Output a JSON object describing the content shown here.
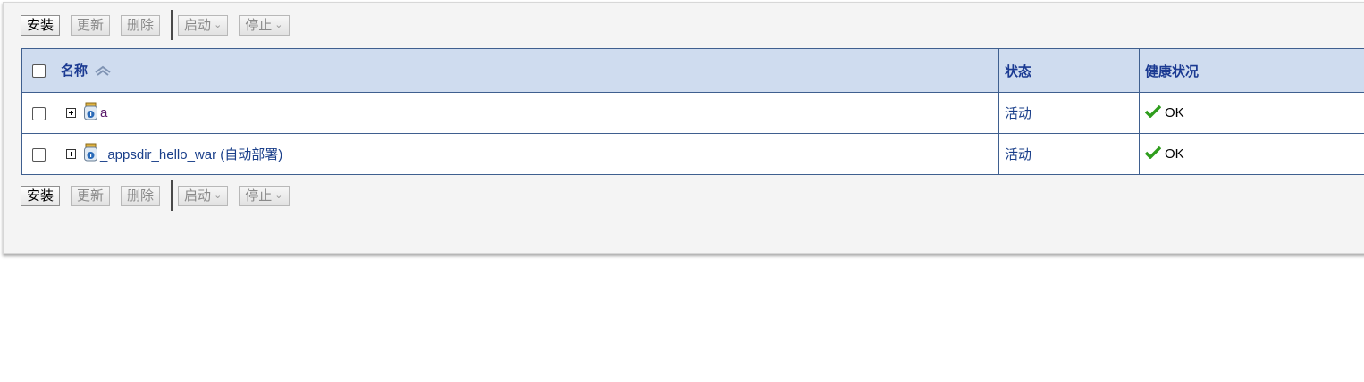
{
  "toolbar": {
    "install": "安装",
    "update": "更新",
    "delete": "删除",
    "start": "启动",
    "stop": "停止"
  },
  "table": {
    "columns": {
      "name": "名称",
      "state": "状态",
      "health": "健康状况"
    },
    "rows": [
      {
        "name": "a",
        "state": "活动",
        "health": "OK"
      },
      {
        "name": "_appsdir_hello_war (自动部署)",
        "state": "活动",
        "health": "OK"
      }
    ]
  },
  "icons": {
    "sort": "sort-ascending-icon",
    "expand": "expand-plus-icon",
    "app": "jar-app-icon",
    "check": "green-check-icon",
    "dropdown": "chevron-down-icon"
  },
  "colors": {
    "header_bg": "#cfdcef",
    "header_text": "#1b3a92",
    "link": "#1a3f8a",
    "ok_green": "#2e9d1c"
  }
}
